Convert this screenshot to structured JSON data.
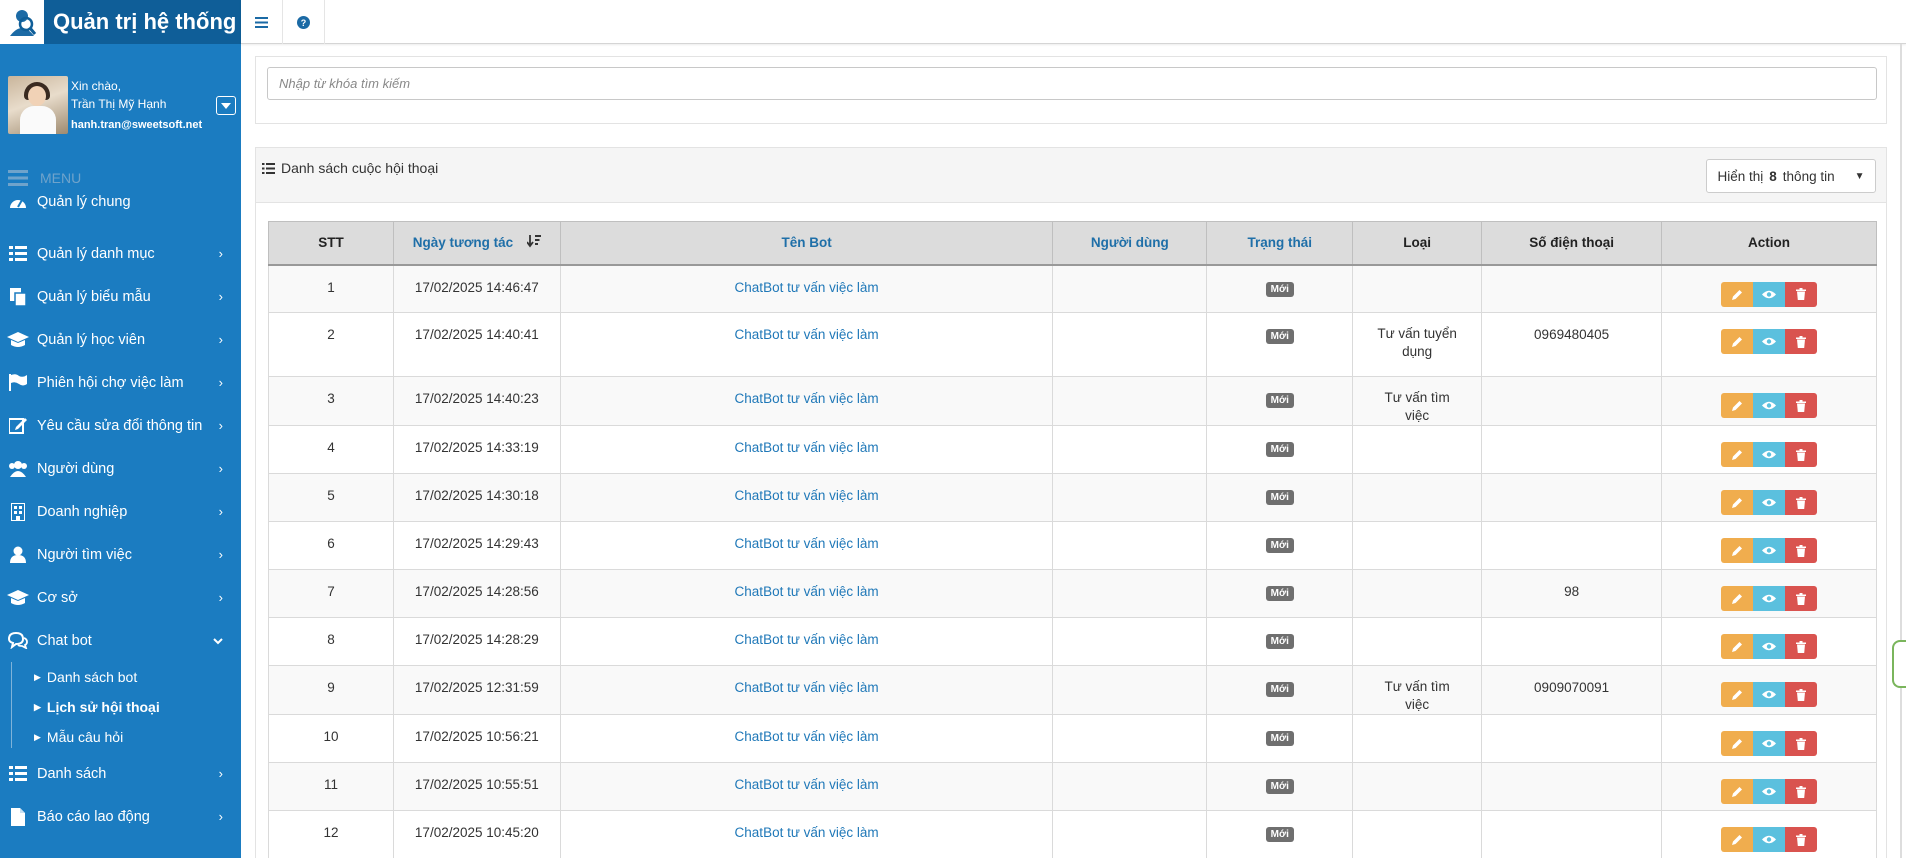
{
  "brand": {
    "title": "Quản trị hệ thống"
  },
  "user": {
    "greeting": "Xin chào,",
    "name": "Trần Thị Mỹ Hạnh",
    "email": "hanh.tran@sweetsoft.net"
  },
  "menu": {
    "header": "MENU",
    "items": [
      {
        "label": "Quản lý chung",
        "icon": "dashboard-icon",
        "chevron": false
      },
      {
        "label": "Quản lý danh mục",
        "icon": "list-icon",
        "chevron": true
      },
      {
        "label": "Quản lý biểu mẫu",
        "icon": "copy-icon",
        "chevron": true
      },
      {
        "label": "Quản lý học viên",
        "icon": "graduation-cap-icon",
        "chevron": true
      },
      {
        "label": "Phiên hội chợ việc làm",
        "icon": "flag-icon",
        "chevron": true
      },
      {
        "label": "Yêu cầu sửa đổi thông tin",
        "icon": "edit-icon",
        "chevron": true
      },
      {
        "label": "Người dùng",
        "icon": "users-icon",
        "chevron": true
      },
      {
        "label": "Doanh nghiệp",
        "icon": "building-icon",
        "chevron": true
      },
      {
        "label": "Người tìm việc",
        "icon": "user-icon",
        "chevron": true
      },
      {
        "label": "Cơ sở",
        "icon": "graduation-cap-icon",
        "chevron": true
      },
      {
        "label": "Chat bot",
        "icon": "comments-icon",
        "chevron": true
      }
    ],
    "chatbot_sub": [
      {
        "label": "Danh sách bot"
      },
      {
        "label": "Lịch sử hội thoại"
      },
      {
        "label": "Mẫu câu hỏi"
      }
    ],
    "after": [
      {
        "label": "Danh sách",
        "icon": "list-icon"
      },
      {
        "label": "Báo cáo lao động",
        "icon": "file-icon"
      }
    ]
  },
  "search": {
    "placeholder": "Nhập từ khóa tìm kiếm"
  },
  "list": {
    "title": "Danh sách cuộc hội thoại",
    "show_prefix": "Hiển thị",
    "show_count": "8",
    "show_suffix": "thông tin"
  },
  "table": {
    "headers": [
      "STT",
      "Ngày tương tác",
      "Tên Bot",
      "Người dùng",
      "Trạng thái",
      "Loại",
      "Số điện thoại",
      "Action"
    ],
    "rows": [
      {
        "stt": "1",
        "date": "17/02/2025 14:46:47",
        "bot": "ChatBot tư vấn việc làm",
        "user": "",
        "status": "Mới",
        "type": "",
        "phone": ""
      },
      {
        "stt": "2",
        "date": "17/02/2025 14:40:41",
        "bot": "ChatBot tư vấn việc làm",
        "user": "",
        "status": "Mới",
        "type": "Tư vấn tuyển dụng",
        "phone": "0969480405"
      },
      {
        "stt": "3",
        "date": "17/02/2025 14:40:23",
        "bot": "ChatBot tư vấn việc làm",
        "user": "",
        "status": "Mới",
        "type": "Tư vấn tìm việc",
        "phone": ""
      },
      {
        "stt": "4",
        "date": "17/02/2025 14:33:19",
        "bot": "ChatBot tư vấn việc làm",
        "user": "",
        "status": "Mới",
        "type": "",
        "phone": ""
      },
      {
        "stt": "5",
        "date": "17/02/2025 14:30:18",
        "bot": "ChatBot tư vấn việc làm",
        "user": "",
        "status": "Mới",
        "type": "",
        "phone": ""
      },
      {
        "stt": "6",
        "date": "17/02/2025 14:29:43",
        "bot": "ChatBot tư vấn việc làm",
        "user": "",
        "status": "Mới",
        "type": "",
        "phone": ""
      },
      {
        "stt": "7",
        "date": "17/02/2025 14:28:56",
        "bot": "ChatBot tư vấn việc làm",
        "user": "",
        "status": "Mới",
        "type": "",
        "phone": "98"
      },
      {
        "stt": "8",
        "date": "17/02/2025 14:28:29",
        "bot": "ChatBot tư vấn việc làm",
        "user": "",
        "status": "Mới",
        "type": "",
        "phone": ""
      },
      {
        "stt": "9",
        "date": "17/02/2025 12:31:59",
        "bot": "ChatBot tư vấn việc làm",
        "user": "",
        "status": "Mới",
        "type": "Tư vấn tìm việc",
        "phone": "0909070091"
      },
      {
        "stt": "10",
        "date": "17/02/2025 10:56:21",
        "bot": "ChatBot tư vấn việc làm",
        "user": "",
        "status": "Mới",
        "type": "",
        "phone": ""
      },
      {
        "stt": "11",
        "date": "17/02/2025 10:55:51",
        "bot": "ChatBot tư vấn việc làm",
        "user": "",
        "status": "Mới",
        "type": "",
        "phone": ""
      },
      {
        "stt": "12",
        "date": "17/02/2025 10:45:20",
        "bot": "ChatBot tư vấn việc làm",
        "user": "",
        "status": "Mới",
        "type": "",
        "phone": ""
      }
    ]
  },
  "colors": {
    "sidebar": "#1b7cc1",
    "brand_bar": "#0f5e98",
    "link": "#1f78b8",
    "edit": "#f0ad4e",
    "view": "#5bc0de",
    "delete": "#d9534f",
    "badge": "#6f6f6f"
  }
}
